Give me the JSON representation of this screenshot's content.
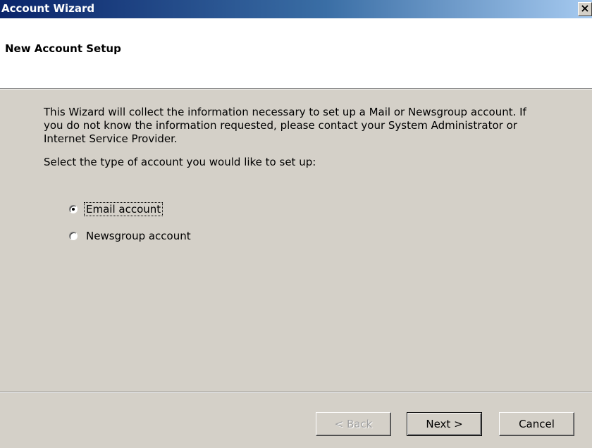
{
  "window": {
    "title": "Account Wizard",
    "close_glyph": "×"
  },
  "header": {
    "title": "New Account Setup"
  },
  "main": {
    "intro": "This Wizard will collect the information necessary to set up a Mail or Newsgroup account. If you do not know the information requested, please contact your System Administrator or Internet Service Provider.",
    "prompt": "Select the type of account you would like to set up:",
    "options": [
      {
        "label": "Email account",
        "selected": true
      },
      {
        "label": "Newsgroup account",
        "selected": false
      }
    ]
  },
  "footer": {
    "back_label": "< Back",
    "next_label": "Next >",
    "cancel_label": "Cancel"
  },
  "colors": {
    "dialog_bg": "#d4d0c8",
    "titlebar_start": "#0a246a",
    "titlebar_end": "#a6caf0"
  }
}
